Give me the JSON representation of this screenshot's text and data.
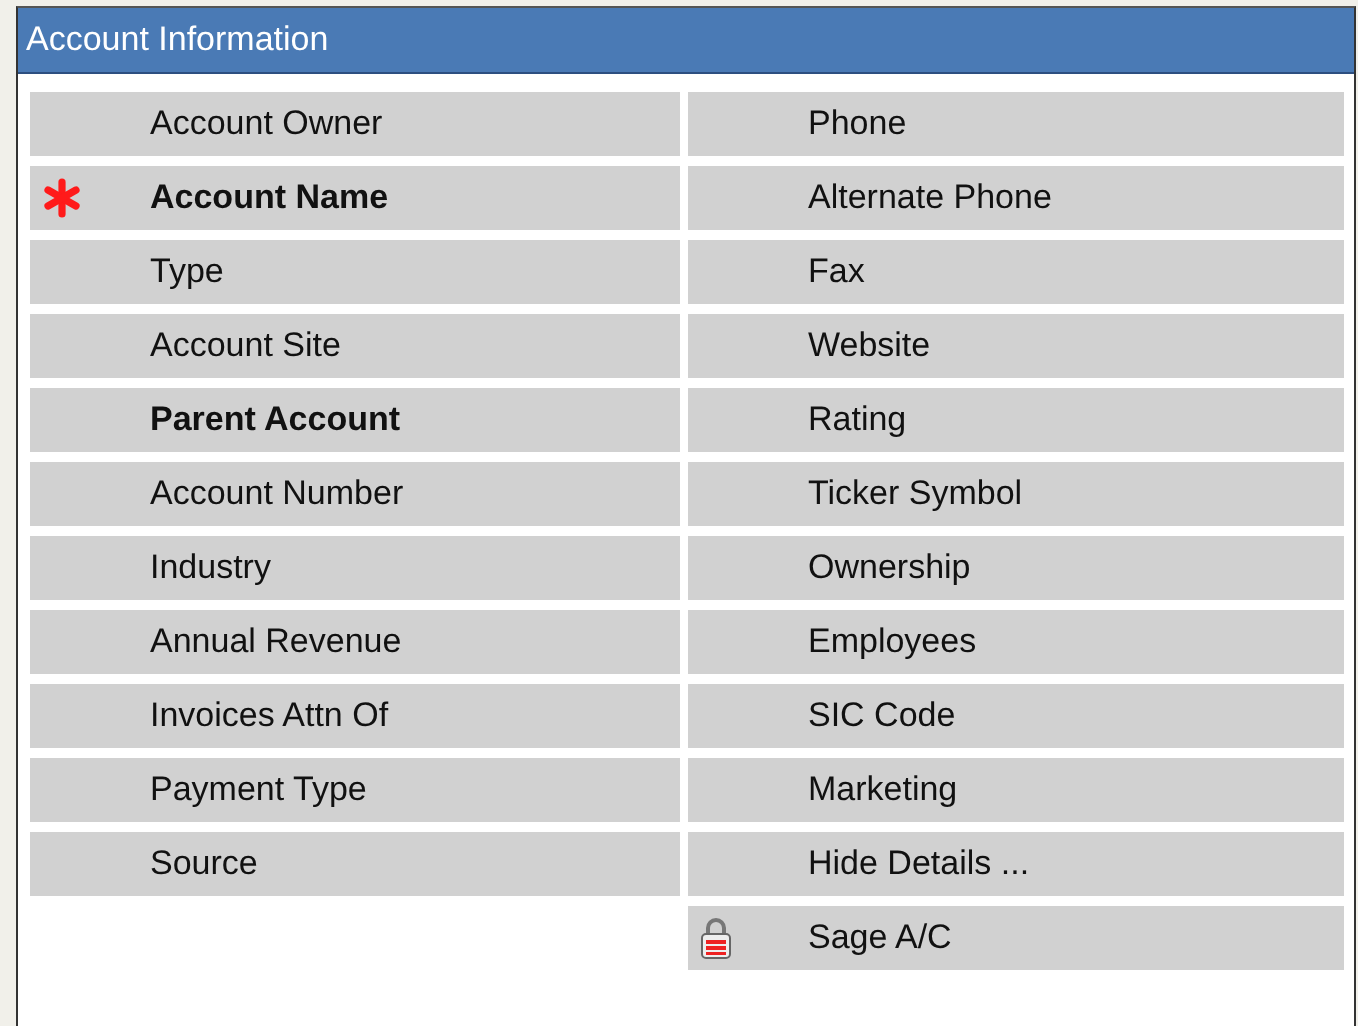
{
  "panel": {
    "title": "Account Information"
  },
  "left_fields": [
    {
      "label": "Account Owner",
      "bold": false,
      "kind": "plain"
    },
    {
      "label": "Account Name",
      "bold": true,
      "kind": "required"
    },
    {
      "label": "Type",
      "bold": false,
      "kind": "plain"
    },
    {
      "label": "Account Site",
      "bold": false,
      "kind": "plain"
    },
    {
      "label": "Parent Account",
      "bold": true,
      "kind": "plain"
    },
    {
      "label": "Account Number",
      "bold": false,
      "kind": "plain"
    },
    {
      "label": "Industry",
      "bold": false,
      "kind": "plain"
    },
    {
      "label": "Annual Revenue",
      "bold": false,
      "kind": "plain"
    },
    {
      "label": "Invoices Attn Of",
      "bold": false,
      "kind": "plain"
    },
    {
      "label": "Payment Type",
      "bold": false,
      "kind": "plain"
    },
    {
      "label": "Source",
      "bold": false,
      "kind": "plain"
    }
  ],
  "right_fields": [
    {
      "label": "Phone",
      "bold": false,
      "kind": "plain"
    },
    {
      "label": "Alternate Phone",
      "bold": false,
      "kind": "plain"
    },
    {
      "label": "Fax",
      "bold": false,
      "kind": "plain"
    },
    {
      "label": "Website",
      "bold": false,
      "kind": "plain"
    },
    {
      "label": "Rating",
      "bold": false,
      "kind": "plain"
    },
    {
      "label": "Ticker Symbol",
      "bold": false,
      "kind": "plain"
    },
    {
      "label": "Ownership",
      "bold": false,
      "kind": "plain"
    },
    {
      "label": "Employees",
      "bold": false,
      "kind": "plain"
    },
    {
      "label": "SIC Code",
      "bold": false,
      "kind": "plain"
    },
    {
      "label": "Marketing",
      "bold": false,
      "kind": "plain"
    },
    {
      "label": "Hide Details ...",
      "bold": false,
      "kind": "plain"
    },
    {
      "label": "Sage A/C",
      "bold": false,
      "kind": "locked"
    }
  ]
}
